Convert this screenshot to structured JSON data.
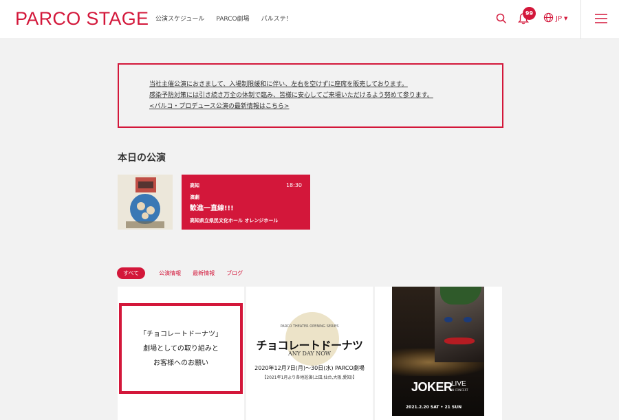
{
  "header": {
    "logo": "PARCO STAGE",
    "nav": [
      "公演スケジュール",
      "PARCO劇場",
      "パルステ！"
    ],
    "notification_count": "99",
    "language": "JP"
  },
  "notice": {
    "lines": [
      "当社主催公演におきまして、入場制限緩和に伴い、左右を空けずに座席を販売しております。",
      "感染予防対策には引き続き万全の体制で臨み、皆様に安心してご来場いただけるよう努めて参ります。",
      "<パルコ・プロデュース公演の最新情報はこちら>"
    ]
  },
  "today": {
    "title": "本日の公演",
    "card": {
      "location": "高知",
      "time": "18:30",
      "genre": "演劇",
      "title": "歓進一直線!!!",
      "venue": "高知県立県民文化ホール オレンジホール"
    }
  },
  "tabs": [
    "すべて",
    "公演情報",
    "最新情報",
    "ブログ"
  ],
  "cards": {
    "choco_notice": {
      "lines": [
        "「チョコレートドーナツ」",
        "劇場としての取り組みと",
        "お客様へのお願い"
      ]
    },
    "choco_poster": {
      "small": "PARCO THEATER OPENING SERIES",
      "title": "チョコレートドーナツ",
      "subtitle": "ANY DAY NOW",
      "date": "2020年12月7日(月)〜30日(水) PARCO劇場",
      "tour": "【2021年1月より各地巡演(上田,仙台,大阪,愛知)】"
    },
    "joker_poster": {
      "title": "JOKER",
      "live": "LIVE",
      "concert": "IN CONCERT",
      "date": "2021.2.20 SAT • 21 SUN"
    }
  },
  "colors": {
    "accent": "#d3173a",
    "background": "#f2f2f2"
  }
}
